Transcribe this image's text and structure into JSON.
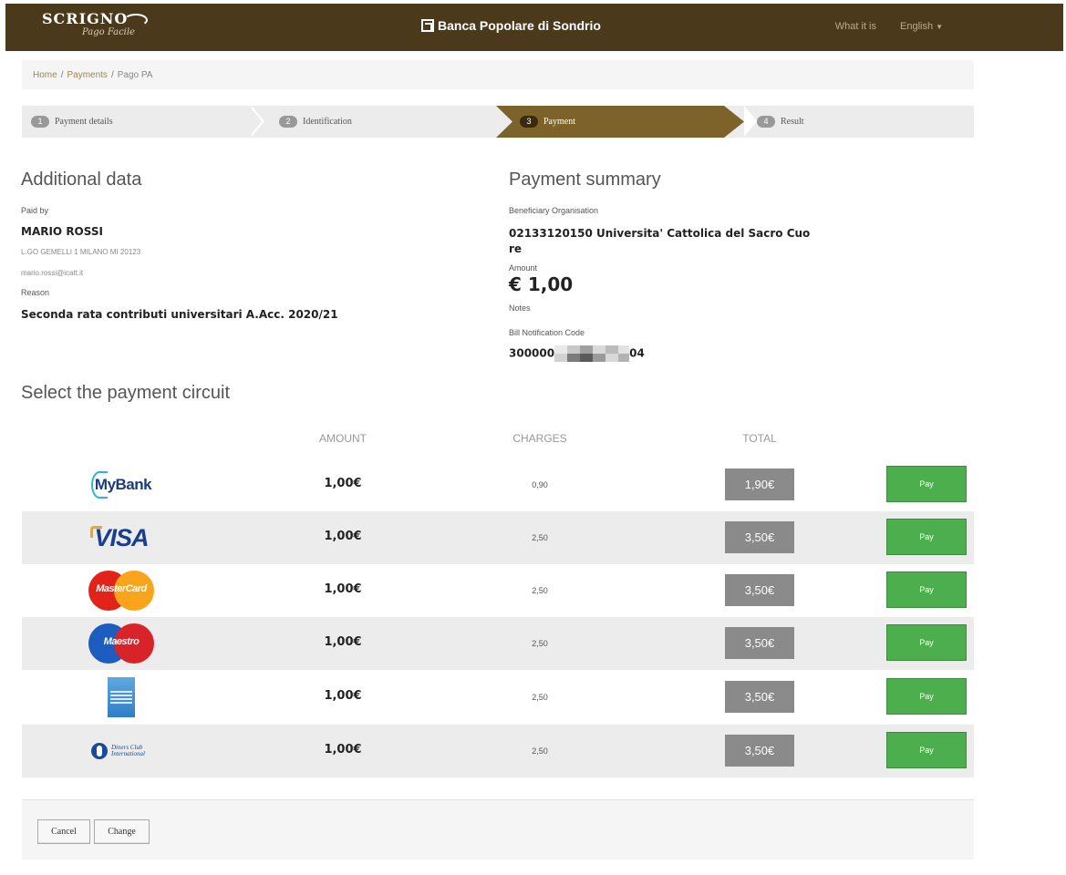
{
  "header": {
    "logo_main": "SCRIGNO",
    "logo_sub": "Pago Facile",
    "bank_name": "Banca Popolare di Sondrio",
    "nav": {
      "what_it_is": "What it is",
      "language": "English"
    }
  },
  "breadcrumb": {
    "home": "Home",
    "payments": "Payments",
    "current": "Pago PA"
  },
  "steps": [
    {
      "num": "1",
      "label": "Payment details"
    },
    {
      "num": "2",
      "label": "Identification"
    },
    {
      "num": "3",
      "label": "Payment"
    },
    {
      "num": "4",
      "label": "Result"
    }
  ],
  "additional": {
    "title": "Additional data",
    "paid_by_label": "Paid by",
    "name": "MARIO ROSSI",
    "address": "L.GO GEMELLI 1 MILANO MI 20123",
    "email": "mario.rossi@icatt.it",
    "reason_label": "Reason",
    "reason": "Seconda rata contributi universitari A.Acc. 2020/21"
  },
  "summary": {
    "title": "Payment summary",
    "beneficiary_label": "Beneficiary Organisation",
    "beneficiary_line1": "02133120150 Universita' Cattolica del Sacro Cuo",
    "beneficiary_line2": "re",
    "amount_label": "Amount",
    "amount": "€ 1,00",
    "notes_label": "Notes",
    "bill_label": "Bill Notification Code",
    "bill_prefix": "300000",
    "bill_suffix": "04"
  },
  "circuits": {
    "title": "Select the payment circuit",
    "headers": {
      "amount": "AMOUNT",
      "charges": "CHARGES",
      "total": "TOTAL"
    },
    "rows": [
      {
        "name": "MyBank",
        "amount": "1,00€",
        "charges": "0,90",
        "total": "1,90€",
        "pay": "Pay"
      },
      {
        "name": "VISA",
        "amount": "1,00€",
        "charges": "2,50",
        "total": "3,50€",
        "pay": "Pay"
      },
      {
        "name": "MasterCard",
        "amount": "1,00€",
        "charges": "2,50",
        "total": "3,50€",
        "pay": "Pay"
      },
      {
        "name": "Maestro",
        "amount": "1,00€",
        "charges": "2,50",
        "total": "3,50€",
        "pay": "Pay"
      },
      {
        "name": "American Express",
        "amount": "1,00€",
        "charges": "2,50",
        "total": "3,50€",
        "pay": "Pay"
      },
      {
        "name": "Diners Club International",
        "amount": "1,00€",
        "charges": "2,50",
        "total": "3,50€",
        "pay": "Pay"
      }
    ]
  },
  "actions": {
    "cancel": "Cancel",
    "change": "Change"
  },
  "colors": {
    "header_bg": "#4a3a1b",
    "active_step": "#7d6229",
    "pay_button": "#4cae4c",
    "total_box": "#8a8a8a"
  }
}
